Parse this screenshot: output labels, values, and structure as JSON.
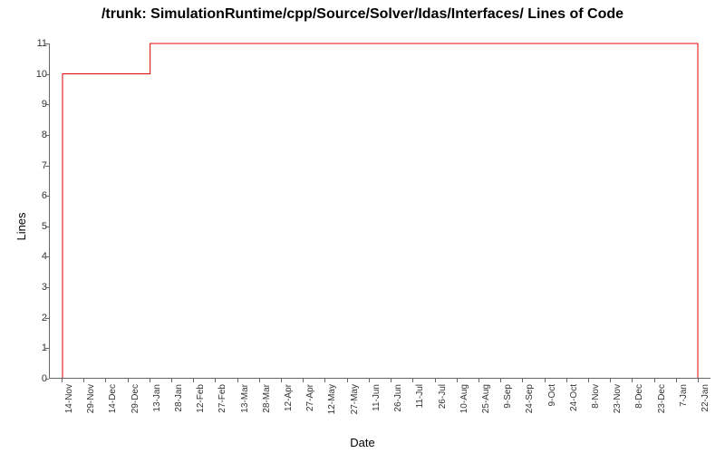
{
  "chart_data": {
    "type": "line",
    "title": "/trunk: SimulationRuntime/cpp/Source/Solver/Idas/Interfaces/ Lines of Code",
    "xlabel": "Date",
    "ylabel": "Lines",
    "ylim": [
      0,
      11
    ],
    "y_ticks": [
      0,
      1,
      2,
      3,
      4,
      5,
      6,
      7,
      8,
      9,
      10,
      11
    ],
    "x_ticks": [
      "14-Nov",
      "29-Nov",
      "14-Dec",
      "29-Dec",
      "13-Jan",
      "28-Jan",
      "12-Feb",
      "27-Feb",
      "13-Mar",
      "28-Mar",
      "12-Apr",
      "27-Apr",
      "12-May",
      "27-May",
      "11-Jun",
      "26-Jun",
      "11-Jul",
      "26-Jul",
      "10-Aug",
      "25-Aug",
      "9-Sep",
      "24-Sep",
      "9-Oct",
      "24-Oct",
      "8-Nov",
      "23-Nov",
      "8-Dec",
      "23-Dec",
      "7-Jan",
      "22-Jan"
    ],
    "series": [
      {
        "name": "Lines of Code",
        "color": "#e00000",
        "points": [
          {
            "x": "14-Nov",
            "y": 0
          },
          {
            "x": "14-Nov",
            "y": 10
          },
          {
            "x": "13-Jan",
            "y": 10
          },
          {
            "x": "13-Jan",
            "y": 11
          },
          {
            "x": "22-Jan",
            "y": 11
          },
          {
            "x": "22-Jan",
            "y": 0
          }
        ]
      }
    ]
  }
}
